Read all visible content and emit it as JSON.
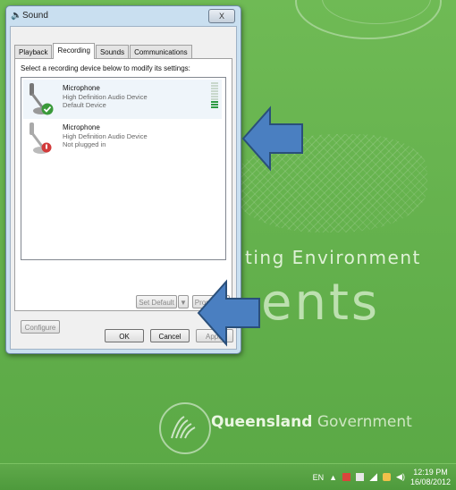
{
  "wallpaper": {
    "line1": "ting Environment",
    "line2": "ents",
    "logo_bold": "Queensland",
    "logo_light": "Government"
  },
  "taskbar": {
    "language": "EN",
    "time": "12:19 PM",
    "date": "16/08/2012"
  },
  "dialog": {
    "title": "Sound",
    "close_label": "X",
    "tabs": [
      {
        "label": "Playback"
      },
      {
        "label": "Recording",
        "active": true
      },
      {
        "label": "Sounds"
      },
      {
        "label": "Communications"
      }
    ],
    "prompt": "Select a recording device below to modify its settings:",
    "devices": [
      {
        "name": "Microphone",
        "description": "High Definition Audio Device",
        "status": "Default Device",
        "status_icon": "check-icon",
        "level_segments_lit": 3,
        "level_segments_total": 10
      },
      {
        "name": "Microphone",
        "description": "High Definition Audio Device",
        "status": "Not plugged in",
        "status_icon": "unplugged-icon"
      }
    ],
    "buttons": {
      "configure": "Configure",
      "set_default": "Set Default",
      "properties": "Properties",
      "ok": "OK",
      "cancel": "Cancel",
      "apply": "Apply"
    }
  },
  "colors": {
    "desktop": "#63b04c",
    "arrow": "#4a7fc1",
    "arrow_outline": "#2a4f7a",
    "level_on": "#2e9a44"
  }
}
